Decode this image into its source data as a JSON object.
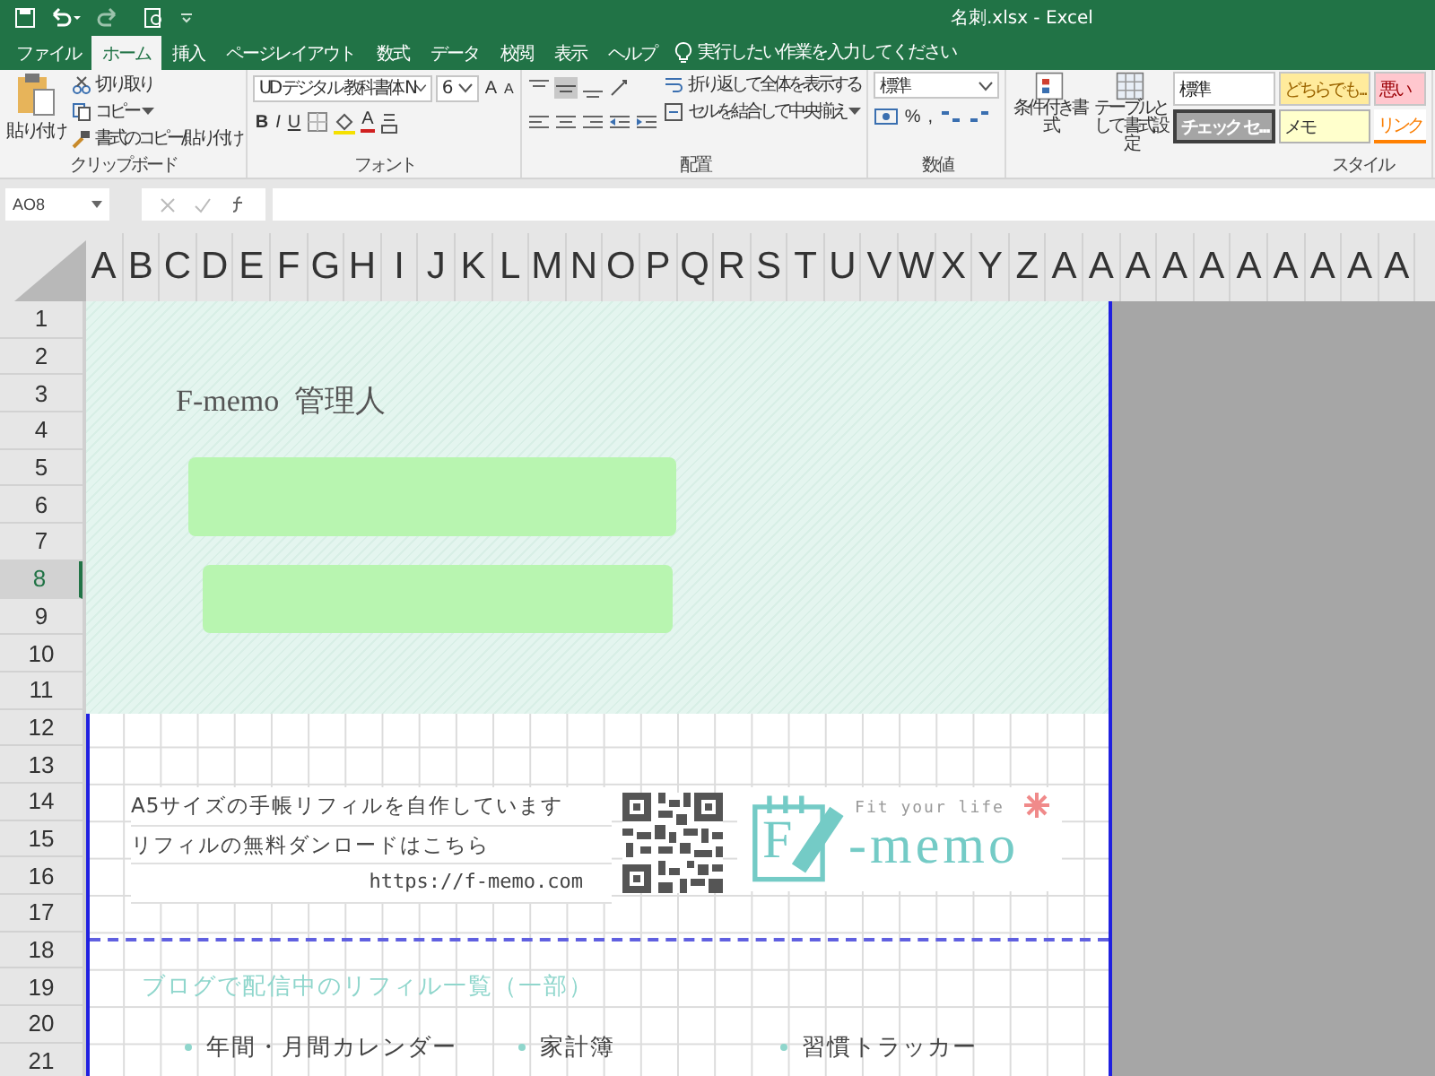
{
  "title_bar": {
    "title": "名刺.xlsx  -  Excel"
  },
  "tabs": [
    {
      "label": "ファイル",
      "selected": false
    },
    {
      "label": "ホーム",
      "selected": true
    },
    {
      "label": "挿入",
      "selected": false
    },
    {
      "label": "ページレイアウト",
      "selected": false
    },
    {
      "label": "数式",
      "selected": false
    },
    {
      "label": "データ",
      "selected": false
    },
    {
      "label": "校閲",
      "selected": false
    },
    {
      "label": "表示",
      "selected": false
    },
    {
      "label": "ヘルプ",
      "selected": false
    }
  ],
  "tell_me": {
    "placeholder": "実行したい作業を入力してください"
  },
  "ribbon": {
    "clipboard": {
      "paste": "貼り付け",
      "cut": "切り取り",
      "copy": "コピー",
      "format_painter": "書式のコピー/貼り付け",
      "label": "クリップボード"
    },
    "font": {
      "font_name": "UD デジタル 教科書体 N",
      "font_size": "6",
      "grow": "A",
      "shrink": "A",
      "bold": "B",
      "italic": "I",
      "underline": "U",
      "font_color": "A",
      "label": "フォント"
    },
    "alignment": {
      "wrap_text": "折り返して全体を表示する",
      "merge_center": "セルを結合して中央揃え",
      "label": "配置"
    },
    "number": {
      "format": "標準",
      "percent": "%",
      "comma": ",",
      "label": "数値"
    },
    "styles": {
      "conditional": "条件付き書式",
      "as_table": "テーブルとして書式設定",
      "label": "スタイル",
      "cells": [
        {
          "label": "標準",
          "kind": "normal"
        },
        {
          "label": "どちらでも...",
          "kind": "neutral"
        },
        {
          "label": "悪い",
          "kind": "bad"
        },
        {
          "label": "チェック セ...",
          "kind": "check"
        },
        {
          "label": "メモ",
          "kind": "note"
        },
        {
          "label": "リンク",
          "kind": "linked"
        }
      ]
    }
  },
  "formula_bar": {
    "name_box": "AO8"
  },
  "sheet": {
    "columns": [
      "A",
      "B",
      "C",
      "D",
      "E",
      "F",
      "G",
      "H",
      "I",
      "J",
      "K",
      "L",
      "M",
      "N",
      "O",
      "P",
      "Q",
      "R",
      "S",
      "T",
      "U",
      "V",
      "W",
      "X",
      "Y",
      "Z",
      "A",
      "A",
      "A",
      "A",
      "A",
      "A",
      "A",
      "A",
      "A",
      "A"
    ],
    "rows": [
      {
        "label": "1",
        "selected": false
      },
      {
        "label": "2",
        "selected": false
      },
      {
        "label": "3",
        "selected": false
      },
      {
        "label": "4",
        "selected": false
      },
      {
        "label": "5",
        "selected": false
      },
      {
        "label": "6",
        "selected": false
      },
      {
        "label": "7",
        "selected": false
      },
      {
        "label": "8",
        "selected": true
      },
      {
        "label": "9",
        "selected": false
      },
      {
        "label": "10",
        "selected": false
      },
      {
        "label": "11",
        "selected": false
      },
      {
        "label": "12",
        "selected": false
      },
      {
        "label": "13",
        "selected": false
      },
      {
        "label": "14",
        "selected": false
      },
      {
        "label": "15",
        "selected": false
      },
      {
        "label": "16",
        "selected": false
      },
      {
        "label": "17",
        "selected": false
      },
      {
        "label": "18",
        "selected": false
      },
      {
        "label": "19",
        "selected": false
      },
      {
        "label": "20",
        "selected": false
      },
      {
        "label": "21",
        "selected": false
      }
    ],
    "card_title": "F-memo  管理人",
    "info_lines": [
      "A5サイズの手帳リフィルを自作しています",
      "リフィルの無料ダンロードはこちら"
    ],
    "url": "https://f-memo.com",
    "logo": {
      "letter": "F",
      "word": "-memo",
      "tagline": "Fit your life"
    },
    "list_heading": "ブログで配信中のリフィル一覧（一部）",
    "list_items": [
      "年間・月間カレンダー",
      "家計簿",
      "習慣トラッカー"
    ]
  }
}
